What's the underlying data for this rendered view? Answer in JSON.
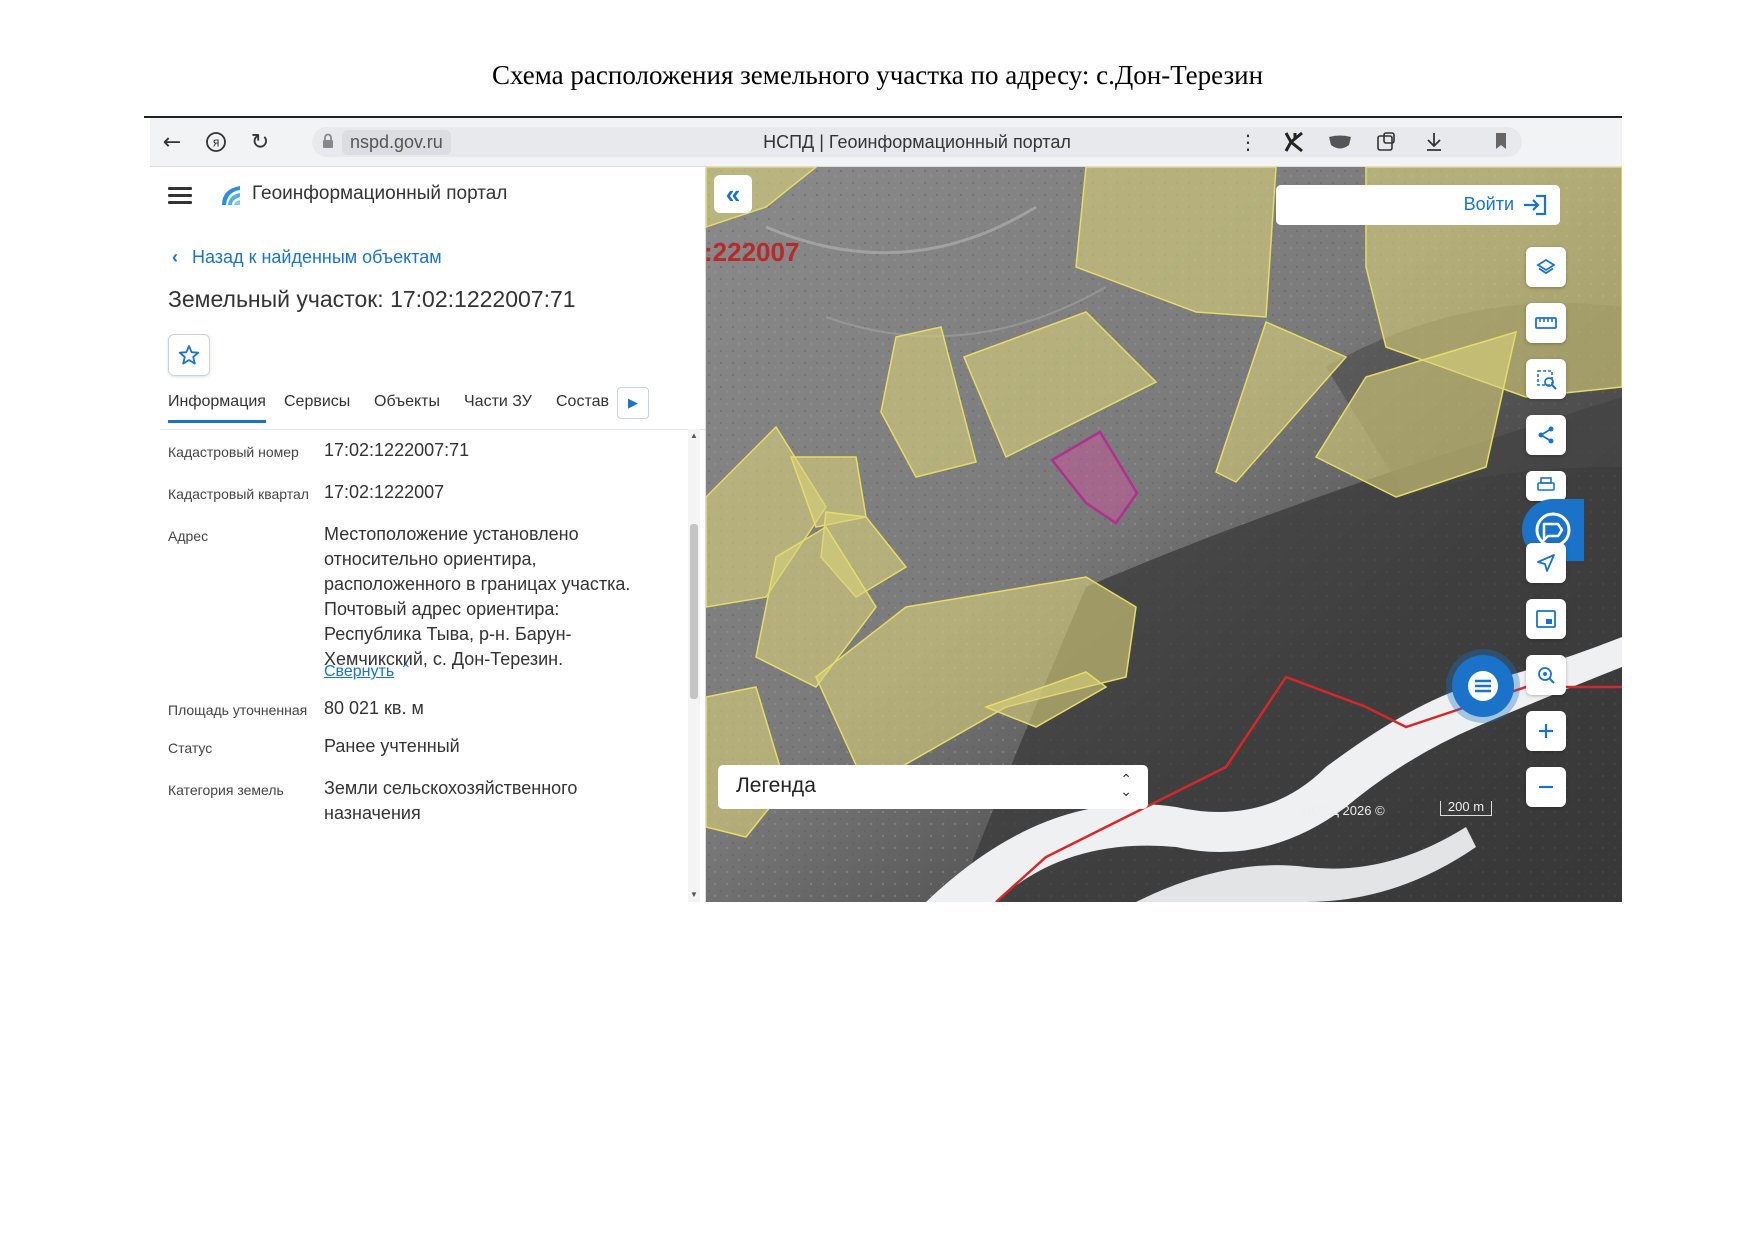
{
  "document": {
    "title": "Схема расположения земельного участка по адресу: с.Дон-Терезин"
  },
  "browser": {
    "url_host": "nspd.gov.ru",
    "page_title": "НСПД | Геоинформационный портал",
    "icons": [
      "back-arrow-icon",
      "yandex-icon",
      "reload-icon",
      "lock-icon",
      "bookmark-icon",
      "more-vert-icon",
      "extension-k-icon",
      "extension-mask-icon",
      "extensions-puzzle-icon",
      "download-icon"
    ]
  },
  "panel": {
    "portal_name": "Геоинформационный портал",
    "back_link": "Назад к найденным объектам",
    "object_title": "Земельный участок: 17:02:1222007:71",
    "tabs": [
      {
        "label": "Информация",
        "active": true
      },
      {
        "label": "Сервисы",
        "active": false
      },
      {
        "label": "Объекты",
        "active": false
      },
      {
        "label": "Части ЗУ",
        "active": false
      },
      {
        "label": "Состав",
        "active": false
      }
    ],
    "fields": {
      "cad_number_label": "Кадастровый номер",
      "cad_number_value": "17:02:1222007:71",
      "cad_block_label": "Кадастровый квартал",
      "cad_block_value": "17:02:1222007",
      "address_label": "Адрес",
      "address_value": "Местоположение установлено относительно ориентира, расположенного в границах участка. Почтовый адрес ориентира: Республика Тыва, р-н. Барун-Хемчикский, с. Дон-Терезин.",
      "collapse_link": "Свернуть",
      "area_label": "Площадь уточненная",
      "area_value": "80 021 кв. м",
      "status_label": "Статус",
      "status_value": "Ранее учтенный",
      "category_label": "Категория земель",
      "category_value": "Земли сельскохозяйственного назначения"
    }
  },
  "map": {
    "login_label": "Войти",
    "cadastral_label": ":222007",
    "legend_label": "Легенда",
    "copyright": "НСПД 2026 ©",
    "scale_label": "200 m",
    "colors": {
      "accent": "#1a73c9",
      "parcel_fill": "#d8d07a",
      "selected_parcel": "#b0308f",
      "boundary_line": "#d62828"
    },
    "tools": [
      "layers-icon",
      "ruler-icon",
      "area-select-icon",
      "share-icon",
      "print-icon",
      "assistant-icon",
      "navigate-icon",
      "minimap-icon",
      "geo-search-icon",
      "zoom-in-icon",
      "zoom-out-icon",
      "chat-icon"
    ]
  }
}
